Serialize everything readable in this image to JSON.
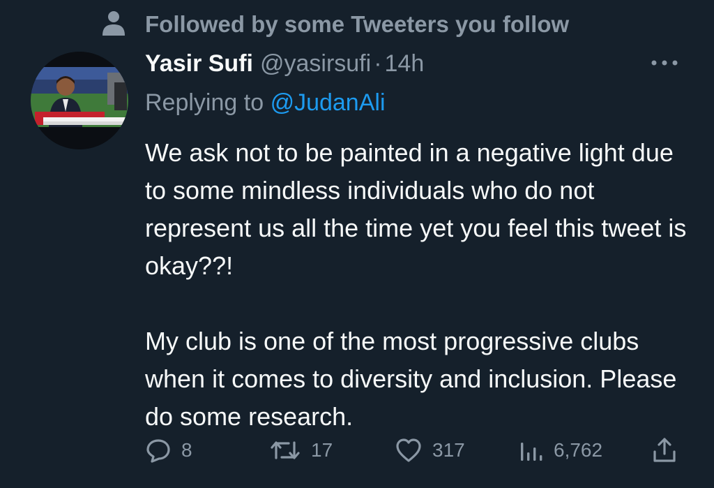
{
  "social_context": {
    "text": "Followed by some Tweeters you follow",
    "icon": "person-icon"
  },
  "tweet": {
    "display_name": "Yasir Sufi",
    "handle": "@yasirsufi",
    "separator": "·",
    "timestamp": "14h",
    "reply_prefix": "Replying to",
    "reply_to": "@JudanAli",
    "paragraphs": [
      "We ask not to be painted in a negative light due to some mindless individuals who do not represent us all the time yet you feel this tweet is okay??!",
      "My club is one of the most progressive clubs when it comes to diversity and inclusion. Please do some research."
    ]
  },
  "actions": {
    "replies": "8",
    "retweets": "17",
    "likes": "317",
    "views": "6,762"
  },
  "colors": {
    "background": "#15202b",
    "primary_text": "#f7f9f9",
    "secondary_text": "#8b98a5",
    "link": "#1d9bf0"
  },
  "icons": [
    "person-icon",
    "more-icon",
    "reply-icon",
    "retweet-icon",
    "like-icon",
    "views-icon",
    "share-icon"
  ]
}
